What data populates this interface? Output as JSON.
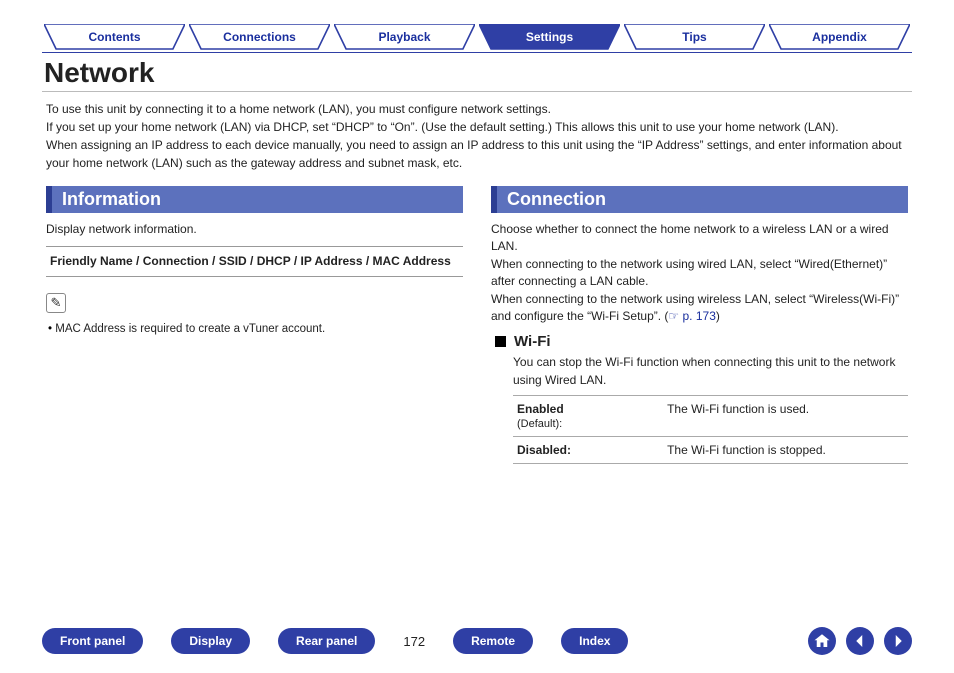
{
  "tabs": [
    {
      "label": "Contents",
      "active": false
    },
    {
      "label": "Connections",
      "active": false
    },
    {
      "label": "Playback",
      "active": false
    },
    {
      "label": "Settings",
      "active": true
    },
    {
      "label": "Tips",
      "active": false
    },
    {
      "label": "Appendix",
      "active": false
    }
  ],
  "title": "Network",
  "intro": "To use this unit by connecting it to a home network (LAN), you must configure network settings.\nIf you set up your home network (LAN) via DHCP, set “DHCP” to “On”. (Use the default setting.) This allows this unit to use your home network (LAN).\nWhen assigning an IP address to each device manually, you need to assign an IP address to this unit using the “IP Address” settings, and enter information about your home network (LAN) such as the gateway address and subnet mask, etc.",
  "left": {
    "header": "Information",
    "desc": "Display network information.",
    "fields": "Friendly Name / Connection / SSID / DHCP / IP Address / MAC Address",
    "note_icon": "✎",
    "note": "MAC Address is required to create a vTuner account."
  },
  "right": {
    "header": "Connection",
    "desc": "Choose whether to connect the home network to a wireless LAN or a wired LAN.\nWhen connecting to the network using wired LAN, select “Wired(Ethernet)” after connecting a LAN cable.\nWhen connecting to the network using wireless LAN, select “Wireless(Wi-Fi)” and configure the “Wi-Fi Setup”. (",
    "ref_label": "☞ p. 173",
    "desc_close": ")",
    "wifi": {
      "title": "Wi-Fi",
      "desc": "You can stop the Wi-Fi function when connecting this unit to the network using Wired LAN.",
      "rows": [
        {
          "key": "Enabled",
          "sub": "(Default):",
          "val": "The Wi-Fi function is used."
        },
        {
          "key": "Disabled:",
          "sub": "",
          "val": "The Wi-Fi function is stopped."
        }
      ]
    }
  },
  "footer": {
    "buttons": [
      "Front panel",
      "Display",
      "Rear panel"
    ],
    "page": "172",
    "buttons2": [
      "Remote",
      "Index"
    ]
  }
}
